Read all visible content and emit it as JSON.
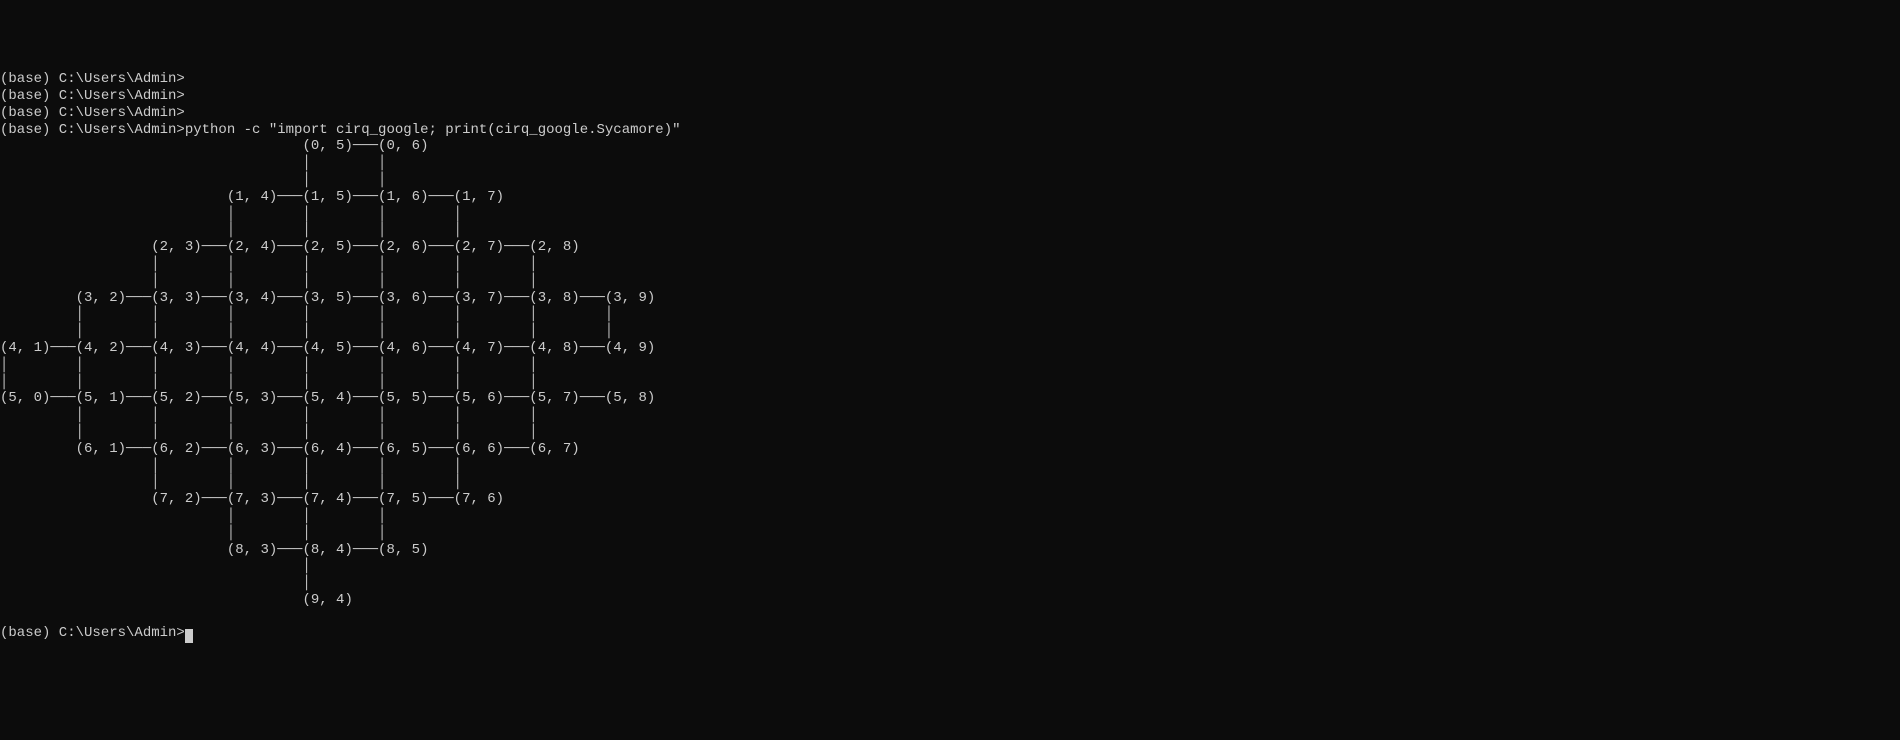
{
  "prompt": "(base) C:\\Users\\Admin>",
  "command": "python -c \"import cirq_google; print(cirq_google.Sycamore)\"",
  "output_lines": [
    "                                         (0, 5)───(0, 6)",
    "                                         │        │",
    "                                         │        │",
    "                                (1, 4)───(1, 5)───(1, 6)───(1, 7)",
    "                                │        │        │        │",
    "                                │        │        │        │",
    "                       (2, 3)───(2, 4)───(2, 5)───(2, 6)───(2, 7)───(2, 8)",
    "                       │        │        │        │        │        │",
    "                       │        │        │        │        │        │",
    "              (3, 2)───(3, 3)───(3, 4)───(3, 5)───(3, 6)───(3, 7)───(3, 8)───(3, 9)",
    "              │        │        │        │        │        │        │        │",
    "              │        │        │        │        │        │        │        │",
    "     (4, 1)───(4, 2)───(4, 3)───(4, 4)───(4, 5)───(4, 6)───(4, 7)───(4, 8)───(4, 9)",
    "     │        │        │        │        │        │        │        │",
    "     │        │        │        │        │        │        │        │",
    "     (5, 0)───(5, 1)───(5, 2)───(5, 3)───(5, 4)───(5, 5)───(5, 6)───(5, 7)───(5, 8)",
    "              │        │        │        │        │        │        │",
    "              │        │        │        │        │        │        │",
    "              (6, 1)───(6, 2)───(6, 3)───(6, 4)───(6, 5)───(6, 6)───(6, 7)",
    "                       │        │        │        │        │",
    "                       │        │        │        │        │",
    "                       (7, 2)───(7, 3)───(7, 4)───(7, 5)───(7, 6)",
    "                                │        │        │",
    "                                │        │        │",
    "                                (8, 3)───(8, 4)───(8, 5)",
    "                                         │",
    "                                         │",
    "                                         (9, 4)"
  ],
  "empty_prompts_before": 3
}
